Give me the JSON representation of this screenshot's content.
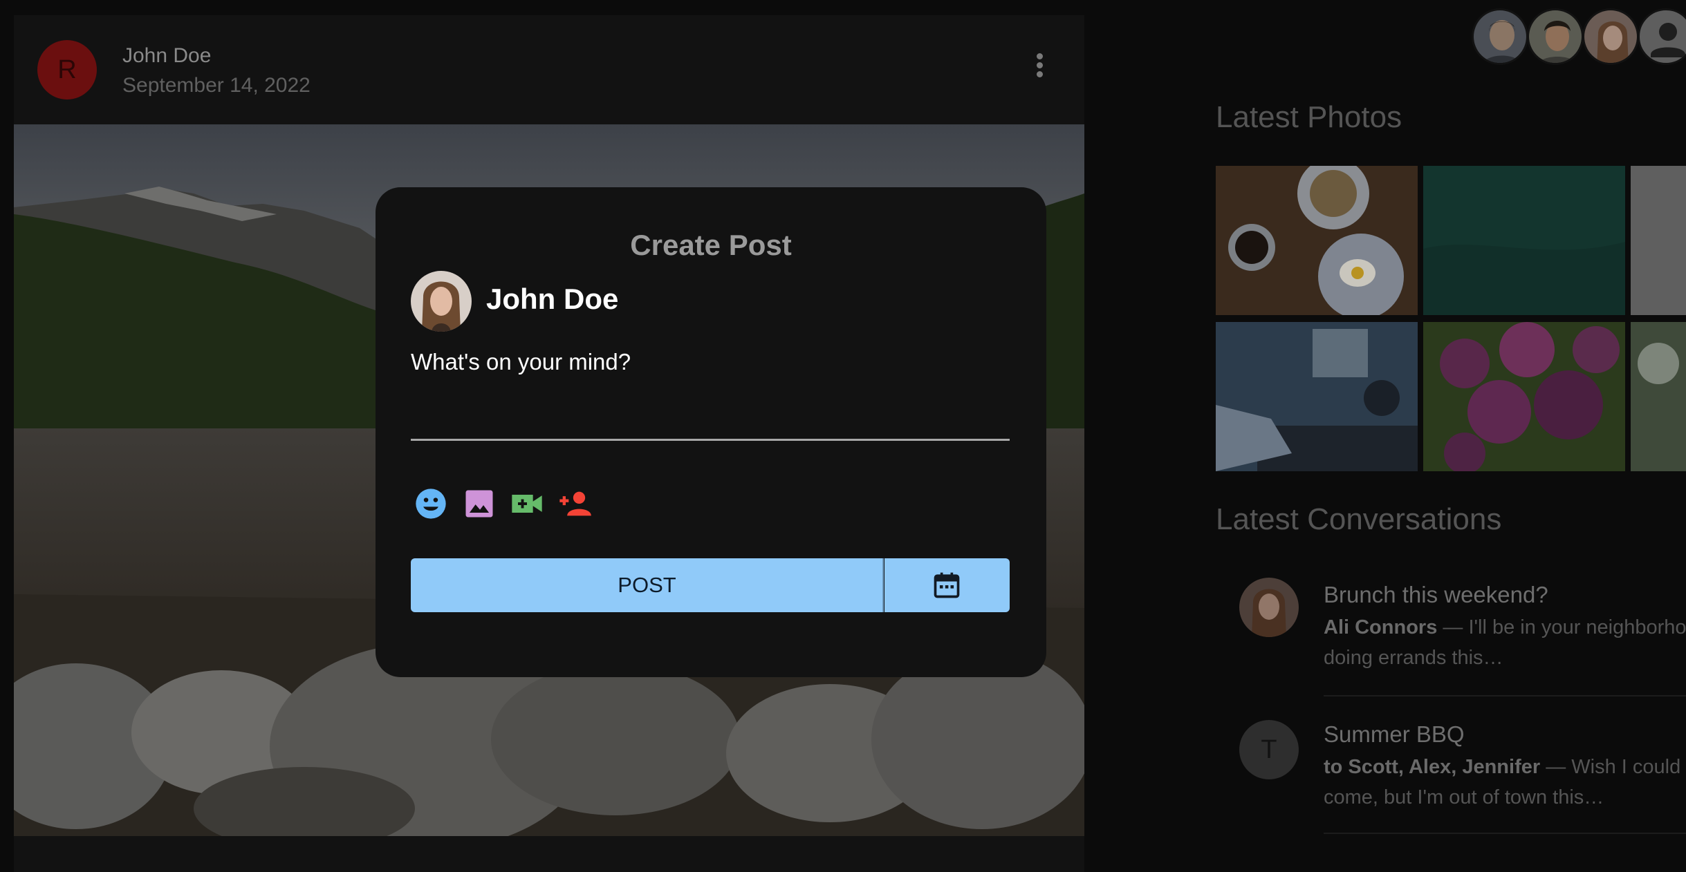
{
  "post": {
    "avatar_letter": "R",
    "author": "John Doe",
    "date": "September 14, 2022"
  },
  "sidebar": {
    "latest_photos_title": "Latest Photos",
    "latest_conversations_title": "Latest Conversations",
    "conversations": [
      {
        "title": "Brunch this weekend?",
        "sender": "Ali Connors",
        "snippet": " — I'll be in your neighborhood",
        "snippet_line2": "doing errands this…"
      },
      {
        "avatar_letter": "T",
        "title": "Summer BBQ",
        "sender": "to Scott, Alex, Jennifer",
        "snippet": " — Wish I could",
        "snippet_line2": "come, but I'm out of town this…"
      }
    ]
  },
  "modal": {
    "title": "Create Post",
    "user_name": "John Doe",
    "input_placeholder": "What's on your mind?",
    "post_label": "POST",
    "icons": [
      "emoji-icon",
      "image-icon",
      "video-camera-icon",
      "tag-person-icon",
      "calendar-icon"
    ],
    "colors": {
      "emoji": "#64b5f6",
      "image": "#ce93d8",
      "video": "#66bb6a",
      "tag_person": "#f44336",
      "post_button": "#90caf9"
    }
  }
}
